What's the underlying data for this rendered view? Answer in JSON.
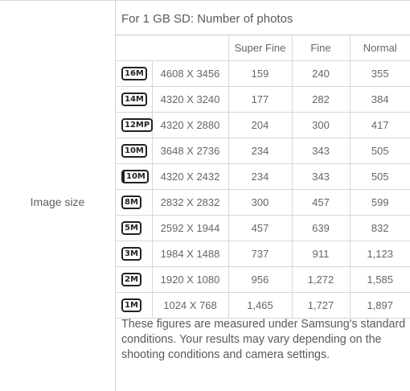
{
  "left_label": "Image size",
  "heading": "For 1 GB SD: Number of photos",
  "columns": {
    "super_fine": "Super Fine",
    "fine": "Fine",
    "normal": "Normal"
  },
  "rows": [
    {
      "icon": "16M",
      "icon_name": "16m-size-icon",
      "resolution": "4608 X 3456",
      "super_fine": "159",
      "fine": "240",
      "normal": "355"
    },
    {
      "icon": "14M",
      "icon_name": "14m-size-icon",
      "resolution": "4320 X 3240",
      "super_fine": "177",
      "fine": "282",
      "normal": "384"
    },
    {
      "icon": "12MP",
      "icon_name": "12mp-size-icon",
      "resolution": "4320 X 2880",
      "super_fine": "204",
      "fine": "300",
      "normal": "417"
    },
    {
      "icon": "10M",
      "icon_name": "10m-size-icon",
      "resolution": "3648 X 2736",
      "super_fine": "234",
      "fine": "343",
      "normal": "505"
    },
    {
      "icon": "10M",
      "icon_name": "10m-wide-size-icon",
      "resolution": "4320 X 2432",
      "super_fine": "234",
      "fine": "343",
      "normal": "505"
    },
    {
      "icon": "8M",
      "icon_name": "8m-size-icon",
      "resolution": "2832 X 2832",
      "super_fine": "300",
      "fine": "457",
      "normal": "599"
    },
    {
      "icon": "5M",
      "icon_name": "5m-size-icon",
      "resolution": "2592 X 1944",
      "super_fine": "457",
      "fine": "639",
      "normal": "832"
    },
    {
      "icon": "3M",
      "icon_name": "3m-size-icon",
      "resolution": "1984 X 1488",
      "super_fine": "737",
      "fine": "911",
      "normal": "1,123"
    },
    {
      "icon": "2M",
      "icon_name": "2m-size-icon",
      "resolution": "1920 X 1080",
      "super_fine": "956",
      "fine": "1,272",
      "normal": "1,585"
    },
    {
      "icon": "1M",
      "icon_name": "1m-size-icon",
      "resolution": "1024 X 768",
      "super_fine": "1,465",
      "fine": "1,727",
      "normal": "1,897"
    }
  ],
  "note": "These figures are measured under Samsung's standard conditions. Your results may vary depending on the shooting conditions and camera settings."
}
